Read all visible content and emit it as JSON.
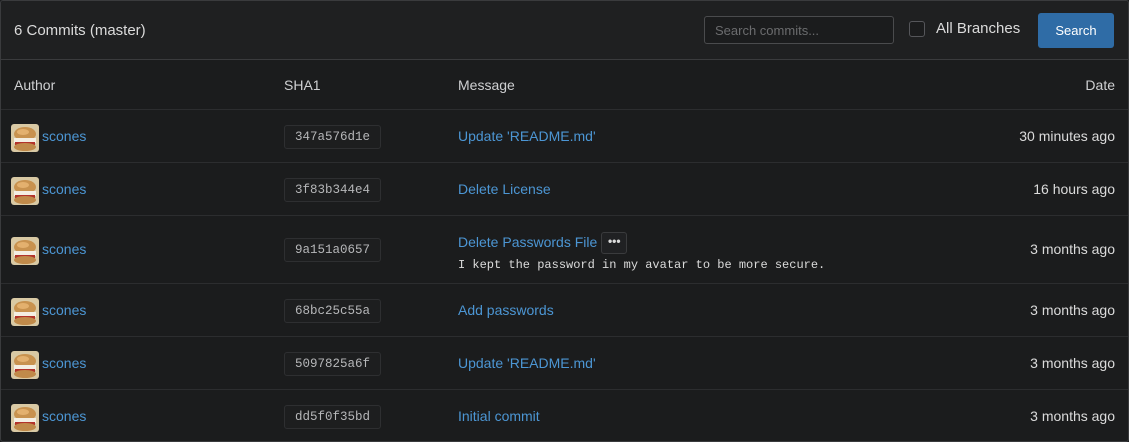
{
  "header": {
    "title": "6 Commits (master)",
    "search_placeholder": "Search commits...",
    "all_branches_label": "All Branches",
    "all_branches_checked": false,
    "search_button_label": "Search"
  },
  "columns": {
    "author": "Author",
    "sha": "SHA1",
    "message": "Message",
    "date": "Date"
  },
  "commits": [
    {
      "author": "scones",
      "sha": "347a576d1e",
      "message": "Update 'README.md'",
      "date": "30 minutes ago"
    },
    {
      "author": "scones",
      "sha": "3f83b344e4",
      "message": "Delete License",
      "date": "16 hours ago"
    },
    {
      "author": "scones",
      "sha": "9a151a0657",
      "message": "Delete Passwords File",
      "has_more_button": true,
      "more_button_label": "•••",
      "description": "I kept the password in my avatar to be more secure.",
      "date": "3 months ago"
    },
    {
      "author": "scones",
      "sha": "68bc25c55a",
      "message": "Add passwords",
      "date": "3 months ago"
    },
    {
      "author": "scones",
      "sha": "5097825a6f",
      "message": "Update 'README.md'",
      "date": "3 months ago"
    },
    {
      "author": "scones",
      "sha": "dd5f0f35bd",
      "message": "Initial commit",
      "date": "3 months ago"
    }
  ],
  "colors": {
    "background": "#1b1c1d",
    "header_background": "#1f2021",
    "link": "#4c96d4",
    "button": "#2f6ca6",
    "text": "#dbdbdb"
  }
}
